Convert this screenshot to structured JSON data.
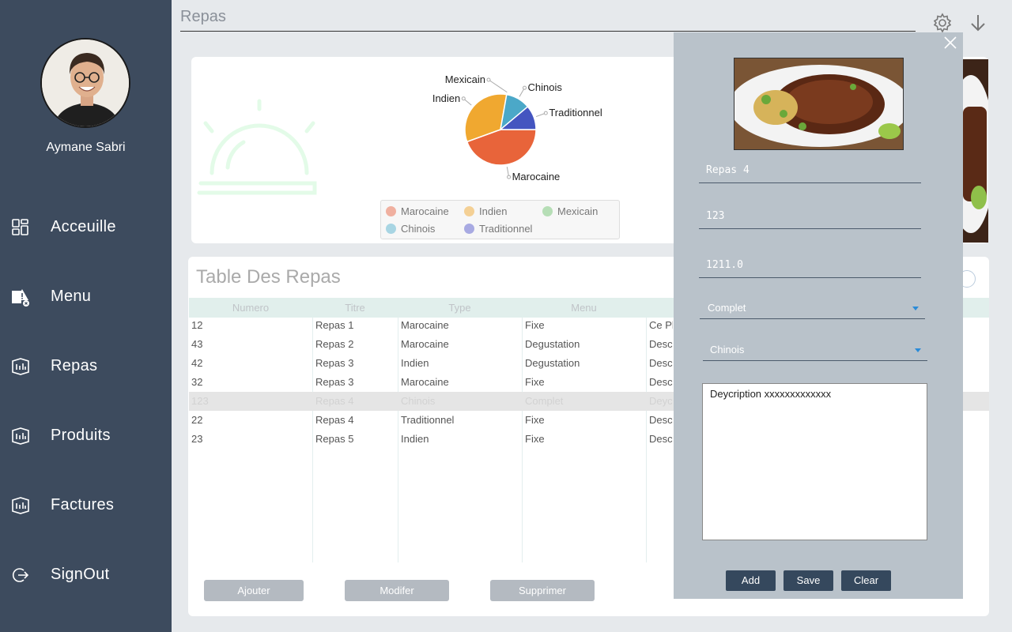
{
  "sidebar": {
    "user_name": "Aymane Sabri",
    "items": [
      {
        "label": "Acceuille",
        "icon": "dashboard-icon"
      },
      {
        "label": "Menu",
        "icon": "menu-alert-icon"
      },
      {
        "label": "Repas",
        "icon": "meal-icon"
      },
      {
        "label": "Produits",
        "icon": "product-icon"
      },
      {
        "label": "Factures",
        "icon": "invoice-icon"
      },
      {
        "label": "SignOut",
        "icon": "signout-icon"
      }
    ]
  },
  "header": {
    "title": "Repas",
    "icons": [
      "gear-icon",
      "download-arrow-icon"
    ]
  },
  "chart_data": {
    "type": "pie",
    "categories": [
      "Marocaine",
      "Indien",
      "Mexicain",
      "Chinois",
      "Traditionnel"
    ],
    "values": [
      4,
      3,
      0,
      1,
      1
    ],
    "colors": [
      "#e8643a",
      "#f0a830",
      "#7bc27c",
      "#4ba8c8",
      "#4455c0"
    ],
    "legend_position": "bottom"
  },
  "table": {
    "title": "Table Des Repas",
    "columns": [
      "Numero",
      "Titre",
      "Type",
      "Menu"
    ],
    "rows": [
      [
        "12",
        "Repas 1",
        "Marocaine",
        "Fixe",
        "Ce Pl"
      ],
      [
        "43",
        "Repas 2",
        "Marocaine",
        "Degustation",
        "Desc"
      ],
      [
        "42",
        "Repas 3",
        "Indien",
        "Degustation",
        "Desc"
      ],
      [
        "32",
        "Repas 3",
        "Marocaine",
        "Fixe",
        "Desc"
      ],
      [
        "123",
        "Repas 4",
        "Chinois",
        "Complet",
        "Deyc"
      ],
      [
        "22",
        "Repas 4",
        "Traditionnel",
        "Fixe",
        "Desc"
      ],
      [
        "23",
        "Repas 5",
        "Indien",
        "Fixe",
        "Desc"
      ]
    ],
    "selected_row": 4
  },
  "actions": {
    "add": "Ajouter",
    "modify": "Modifer",
    "delete": "Supprimer"
  },
  "form": {
    "titre": "Repas 4",
    "numero": "123",
    "prix": "1211.0",
    "menu": "Complet",
    "type": "Chinois",
    "description": "Deycription xxxxxxxxxxxxx",
    "buttons": {
      "add": "Add",
      "save": "Save",
      "clear": "Clear"
    }
  },
  "colors": {
    "sidebar": "#3d4b5e",
    "panel": "#b9c2ca",
    "primary_button": "#35485d"
  }
}
